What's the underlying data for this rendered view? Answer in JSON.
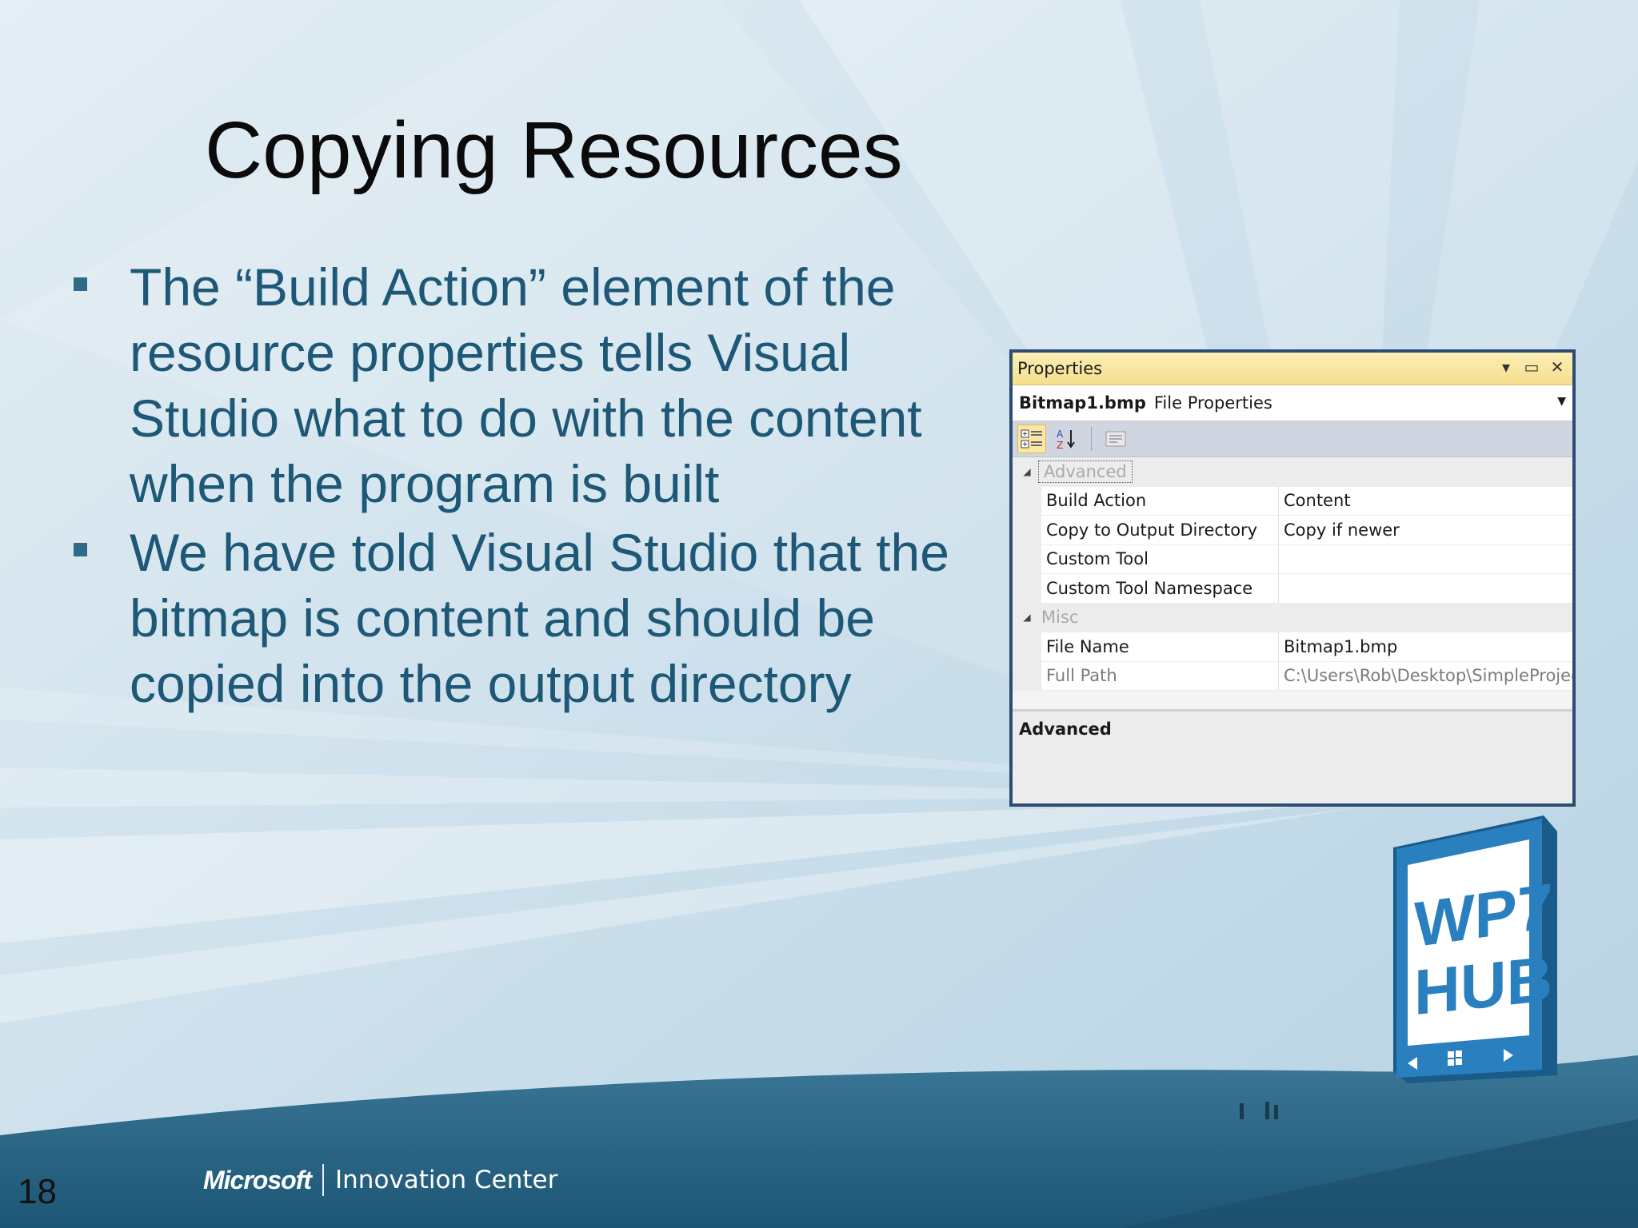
{
  "slide": {
    "title": "Copying Resources",
    "bullets": [
      "The “Build Action” element of the resource properties tells Visual Studio what to do with the content when the program is built",
      "We have told Visual Studio that the bitmap is content and should be copied into the output directory"
    ],
    "slide_number": "18",
    "footer": {
      "brand": "Microsoft",
      "product": "Innovation Center"
    },
    "badge": {
      "line1": "WP7",
      "line2": "HUB"
    }
  },
  "properties_window": {
    "title": "Properties",
    "object_name": "Bitmap1.bmp",
    "object_type": "File Properties",
    "categories": [
      {
        "label": "Advanced",
        "rows": [
          {
            "name": "Build Action",
            "value": "Content"
          },
          {
            "name": "Copy to Output Directory",
            "value": "Copy if newer"
          },
          {
            "name": "Custom Tool",
            "value": ""
          },
          {
            "name": "Custom Tool Namespace",
            "value": ""
          }
        ]
      },
      {
        "label": "Misc",
        "rows": [
          {
            "name": "File Name",
            "value": "Bitmap1.bmp"
          },
          {
            "name": "Full Path",
            "value": "C:\\Users\\Rob\\Desktop\\SimpleProjec"
          }
        ]
      }
    ],
    "description_title": "Advanced",
    "icons": [
      "categorized-icon",
      "alphabetical-icon",
      "property-pages-icon",
      "dropdown-arrow-icon",
      "maximize-icon",
      "close-icon"
    ]
  },
  "colors": {
    "title": "#0b0b0b",
    "body_text": "#1e5877",
    "accent_border": "#2e4c73",
    "titlebar": "#f5df8e"
  }
}
